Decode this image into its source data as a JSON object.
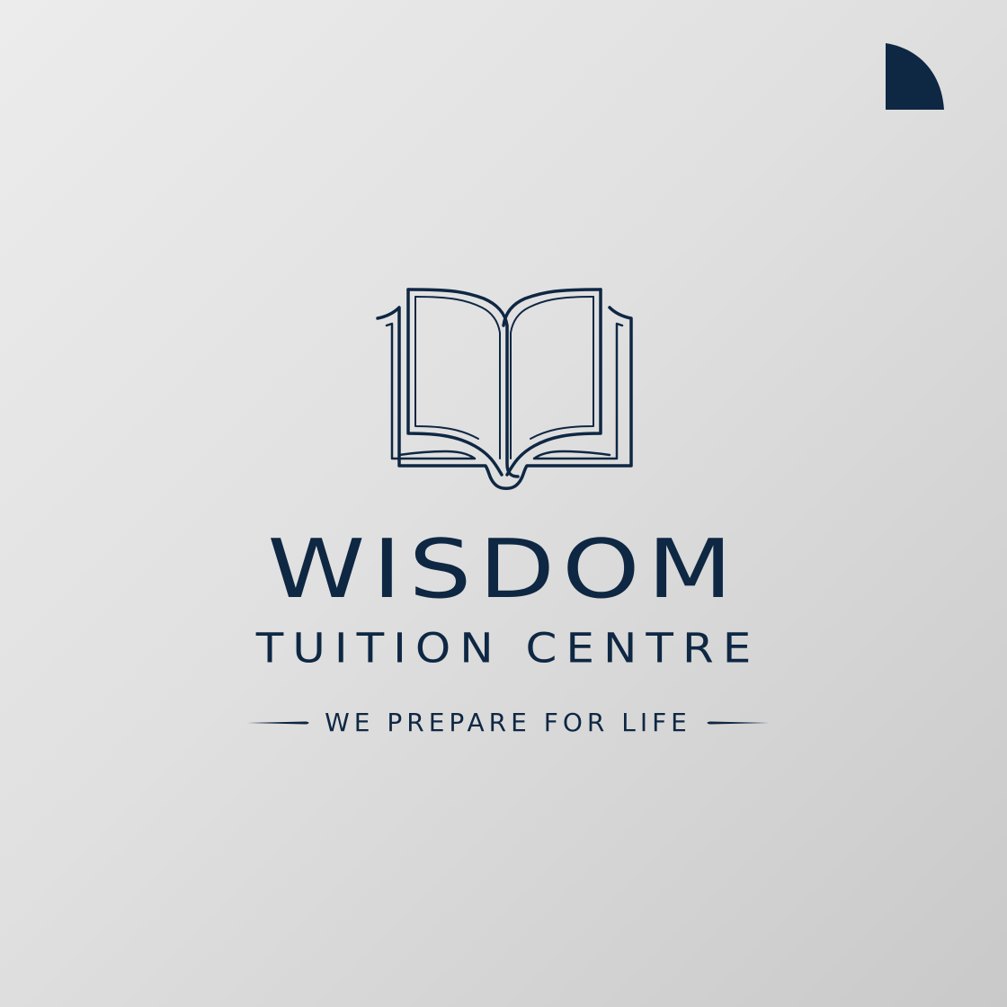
{
  "colors": {
    "ink": "#0e2743",
    "background": "#e4e4e4"
  },
  "icons": {
    "corner": "quarter-circle-mark-icon",
    "emblem": "open-book-icon"
  },
  "logo": {
    "name": "WISDOM",
    "subtitle": "TUITION CENTRE",
    "tagline": "WE PREPARE FOR LIFE"
  }
}
